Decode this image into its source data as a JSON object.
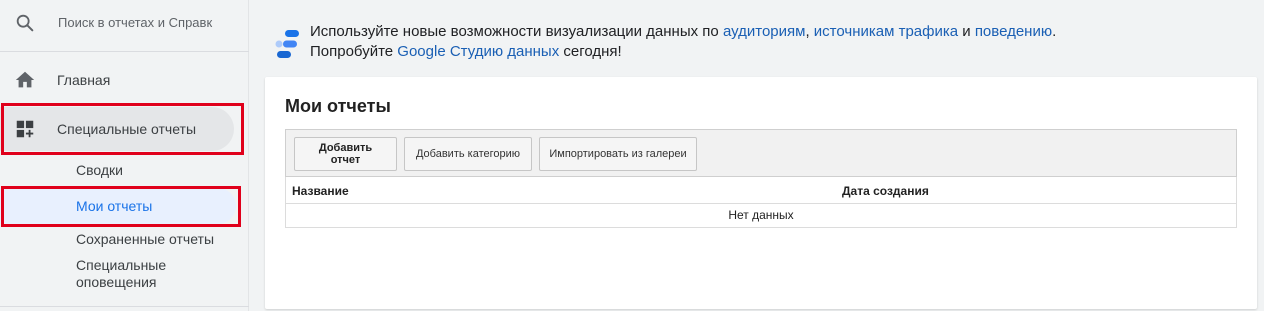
{
  "sidebar": {
    "search": {
      "placeholder": "Поиск в отчетах и Справк"
    },
    "home": {
      "label": "Главная"
    },
    "custom_reports": {
      "label": "Специальные отчеты"
    },
    "sub_items": [
      {
        "label": "Сводки"
      },
      {
        "label": "Мои отчеты",
        "selected": true
      },
      {
        "label": "Сохраненные отчеты"
      },
      {
        "label": "Специальные оповещения"
      }
    ]
  },
  "banner": {
    "text_1": "Используйте новые возможности визуализации данных по ",
    "link_audiences": "аудиториям",
    "sep_1": ", ",
    "link_traffic": "источникам трафика",
    "sep_2": " и ",
    "link_behavior": "поведению",
    "end_1": ".",
    "text_2": "Попробуйте ",
    "link_studio": "Google Студию данных",
    "end_2": " сегодня!"
  },
  "card": {
    "title": "Мои отчеты",
    "toolbar": {
      "add_report": "Добавить отчет",
      "add_category": "Добавить категорию",
      "import_gallery": "Импортировать из галереи"
    },
    "table": {
      "columns": [
        "Название",
        "Дата создания"
      ],
      "empty_text": "Нет данных"
    }
  },
  "colors": {
    "accent": "#1a73e8",
    "link": "#1a5fb4",
    "highlight_border": "#e0001b",
    "selected_bg": "#e8f0fe"
  }
}
